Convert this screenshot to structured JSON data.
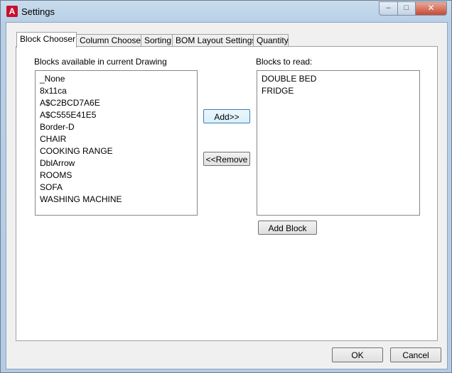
{
  "window": {
    "title": "Settings",
    "icon": "autocad-a-icon",
    "min_glyph": "–",
    "max_glyph": "□",
    "close_glyph": "✕"
  },
  "tabs": [
    {
      "label": "Block Chooser",
      "active": true
    },
    {
      "label": "Column Chooser",
      "active": false
    },
    {
      "label": "Sorting",
      "active": false
    },
    {
      "label": "BOM Layout Settings",
      "active": false
    },
    {
      "label": "Quantity",
      "active": false
    }
  ],
  "available": {
    "label": "Blocks available in current Drawing",
    "items": [
      "_None",
      "8x11ca",
      "A$C2BCD7A6E",
      "A$C555E41E5",
      "Border-D",
      "CHAIR",
      "COOKING RANGE",
      "DblArrow",
      "ROOMS",
      "SOFA",
      "WASHING MACHINE"
    ]
  },
  "to_read": {
    "label": "Blocks to read:",
    "items": [
      "DOUBLE BED",
      "FRIDGE"
    ]
  },
  "buttons": {
    "add": "Add>>",
    "remove": "<<Remove",
    "add_block": "Add Block",
    "ok": "OK",
    "cancel": "Cancel"
  }
}
